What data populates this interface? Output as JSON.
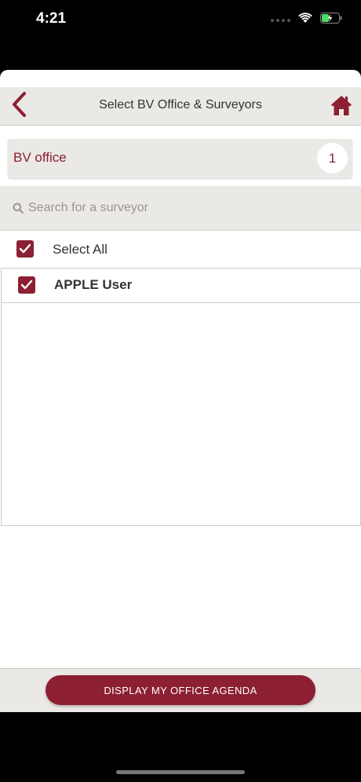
{
  "status_bar": {
    "time": "4:21",
    "signal_icon": "cellular-dots-icon",
    "wifi_icon": "wifi-icon",
    "battery_icon": "battery-charging-icon",
    "battery_color": "#4cd964"
  },
  "header": {
    "title": "Select BV Office & Surveyors",
    "back_icon": "chevron-left-icon",
    "home_icon": "home-icon"
  },
  "office": {
    "label": "BV office",
    "count": "1"
  },
  "search": {
    "placeholder": "Search for a surveyor",
    "value": "",
    "icon": "search-icon"
  },
  "select_all": {
    "label": "Select All",
    "checked": true
  },
  "surveyors": [
    {
      "label": "APPLE User",
      "checked": true
    }
  ],
  "footer": {
    "button_label": "DISPLAY MY OFFICE AGENDA"
  },
  "colors": {
    "accent": "#8c1f32",
    "bar_bg": "#ebe9e6"
  }
}
